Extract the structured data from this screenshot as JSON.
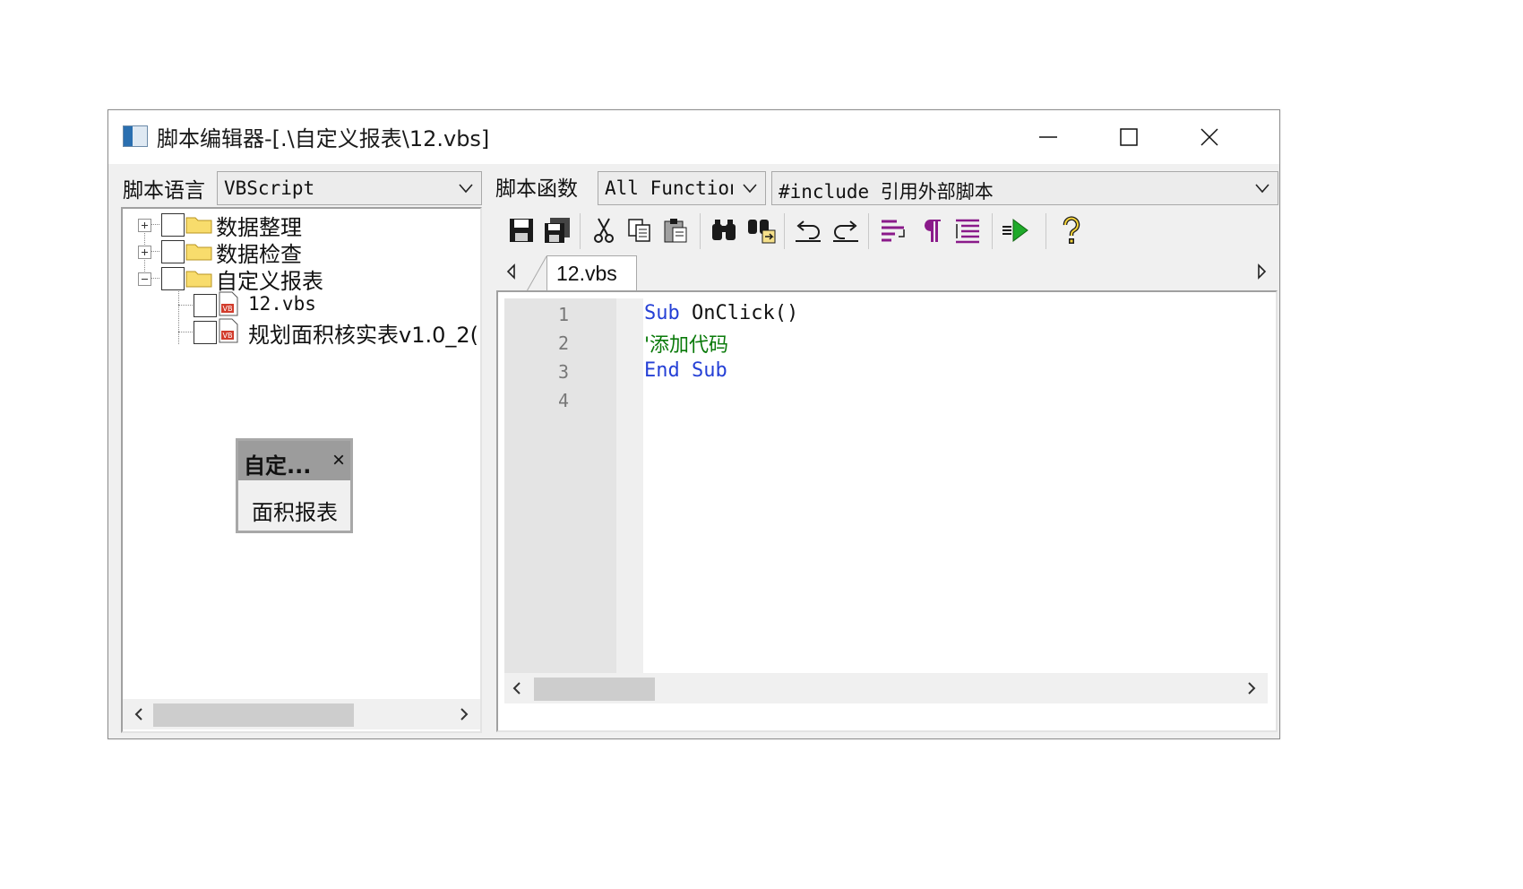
{
  "window": {
    "title": "脚本编辑器-[.\\自定义报表\\12.vbs]",
    "controls": {
      "minimize": "minimize-icon",
      "maximize": "maximize-icon",
      "close": "close-icon"
    }
  },
  "language": {
    "label": "脚本语言",
    "value": "VBScript"
  },
  "tree": {
    "nodes": [
      {
        "label": "数据整理",
        "type": "folder",
        "expander": "+"
      },
      {
        "label": "数据检查",
        "type": "folder",
        "expander": "+"
      },
      {
        "label": "自定义报表",
        "type": "folder",
        "expander": "-"
      },
      {
        "label": "12.vbs",
        "type": "file"
      },
      {
        "label": "规划面积核实表v1.0_2(",
        "type": "file"
      }
    ]
  },
  "popup": {
    "title": "自定...",
    "close": "×",
    "item": "面积报表"
  },
  "functions": {
    "label": "脚本函数",
    "filter_value": "All Function",
    "include_value": "#include 引用外部脚本"
  },
  "toolbar": {
    "icons": [
      "save-icon",
      "save-all-icon",
      "cut-icon",
      "copy-icon",
      "paste-icon",
      "find-icon",
      "replace-icon",
      "undo-icon",
      "redo-icon",
      "word-wrap-icon",
      "show-whitespace-icon",
      "format-icon",
      "run-icon",
      "help-icon"
    ]
  },
  "tabs": [
    {
      "label": "12.vbs",
      "active": true
    }
  ],
  "editor": {
    "line_numbers": [
      "1",
      "2",
      "3",
      "4"
    ],
    "lines": [
      {
        "kw1": "Sub",
        "rest": "OnClick()"
      },
      {
        "comment": "'添加代码"
      },
      {
        "kw1": "End",
        "kw2": "Sub"
      },
      {}
    ]
  },
  "colors": {
    "keyword": "#2540d6",
    "comment": "#0a7a0a",
    "gutter": "#e4e4e4",
    "window_bg": "#f0f0f0"
  }
}
